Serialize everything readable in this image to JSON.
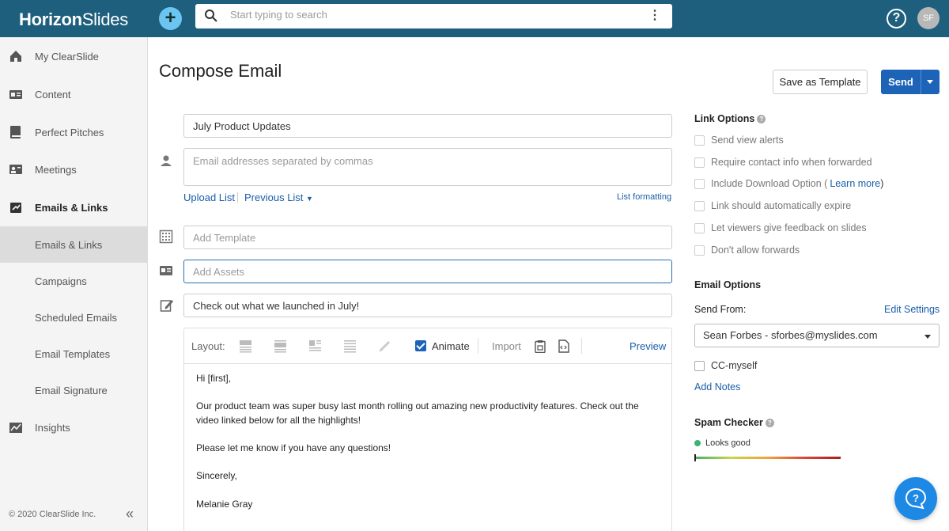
{
  "header": {
    "logo_bold": "Horizon",
    "logo_rest": "Slides",
    "add_label": "+",
    "search_placeholder": "Start typing to search",
    "help_label": "?",
    "avatar_initials": "SF"
  },
  "sidebar": {
    "items": [
      {
        "label": "My ClearSlide",
        "icon": "home-icon"
      },
      {
        "label": "Content",
        "icon": "id-card-icon"
      },
      {
        "label": "Perfect Pitches",
        "icon": "book-icon"
      },
      {
        "label": "Meetings",
        "icon": "meeting-icon"
      },
      {
        "label": "Emails & Links",
        "icon": "email-link-icon"
      },
      {
        "label": "Emails & Links"
      },
      {
        "label": "Campaigns"
      },
      {
        "label": "Scheduled Emails"
      },
      {
        "label": "Email Templates"
      },
      {
        "label": "Email Signature"
      },
      {
        "label": "Insights",
        "icon": "chart-icon"
      }
    ],
    "footer": "© 2020 ClearSlide Inc.",
    "collapse_label": "«"
  },
  "compose": {
    "title": "Compose Email",
    "save_template_label": "Save as Template",
    "send_label": "Send",
    "subject_value": "July Product Updates",
    "recipients_placeholder": "Email addresses separated by commas",
    "upload_list": "Upload List",
    "previous_list": "Previous List",
    "list_formatting": "List formatting",
    "template_placeholder": "Add Template",
    "assets_placeholder": "Add Assets",
    "message_subject": "Check out what we launched in July!"
  },
  "toolbar": {
    "layout_label": "Layout:",
    "animate_label": "Animate",
    "import_label": "Import",
    "preview_label": "Preview"
  },
  "body": {
    "greeting": "Hi [first],",
    "para1": "Our product team was super busy last month rolling out amazing new productivity features. Check out the video linked below for all the highlights!",
    "para2": "Please let me know if you have any questions!",
    "closing": "Sincerely,",
    "signature": "Melanie Gray"
  },
  "link_options": {
    "heading": "Link Options",
    "items": [
      "Send view alerts",
      "Require contact info when forwarded",
      "Include Download Option (",
      "Link should automatically expire",
      "Let viewers give feedback on slides",
      "Don't allow forwards"
    ],
    "learn_more": "Learn more",
    "close_paren": ")"
  },
  "email_options": {
    "heading": "Email Options",
    "send_from_label": "Send From:",
    "edit_settings": "Edit Settings",
    "send_from_value": "Sean Forbes - sforbes@myslides.com",
    "cc_label": "CC-myself",
    "add_notes": "Add Notes"
  },
  "spam": {
    "heading": "Spam Checker",
    "status": "Looks good"
  },
  "colors": {
    "topbar": "#1e5f7e",
    "accent": "#1d63b8",
    "link": "#1a5ea8"
  }
}
